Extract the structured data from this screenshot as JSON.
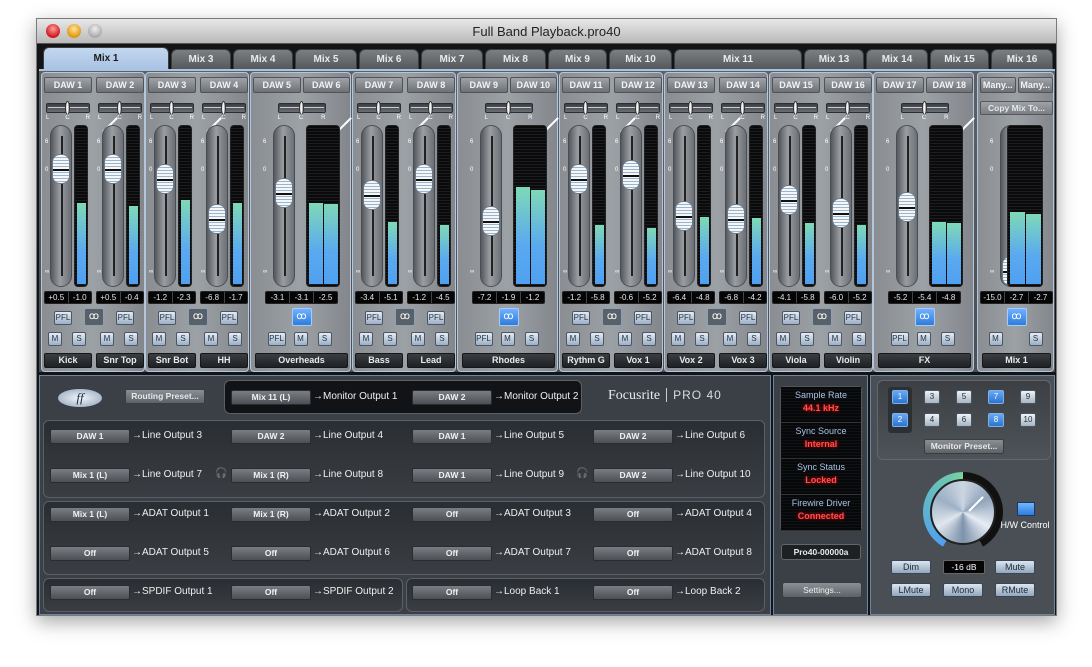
{
  "window": {
    "title": "Full Band Playback.pro40"
  },
  "tabs": [
    {
      "label": "Mix 1",
      "active": true
    },
    {
      "label": "Mix 3"
    },
    {
      "label": "Mix 4"
    },
    {
      "label": "Mix 5"
    },
    {
      "label": "Mix 6"
    },
    {
      "label": "Mix 7"
    },
    {
      "label": "Mix 8"
    },
    {
      "label": "Mix 9"
    },
    {
      "label": "Mix 10"
    },
    {
      "label": "Mix 11"
    },
    {
      "label": "Mix 13"
    },
    {
      "label": "Mix 14"
    },
    {
      "label": "Mix 15"
    },
    {
      "label": "Mix 16"
    }
  ],
  "channels": [
    {
      "name": "Kick",
      "stereo": false,
      "sources": [
        "DAW 1"
      ],
      "readouts": [
        "+0.5"
      ],
      "fader_db": 0.5,
      "meter": [
        0.52
      ]
    },
    {
      "name": "Snr Top",
      "stereo": false,
      "sources": [
        "DAW 2"
      ],
      "readouts": [
        "+0.5"
      ],
      "fader_db": 0.5,
      "meter": [
        0.5
      ]
    },
    {
      "name": "Snr Bot",
      "stereo": false,
      "sources": [
        "DAW 3"
      ],
      "readouts": [
        "-1.2"
      ],
      "fader_db": -1.2,
      "meter": [
        0.54
      ]
    },
    {
      "name": "HH",
      "stereo": false,
      "sources": [
        "DAW 4"
      ],
      "readouts": [
        "-6.8"
      ],
      "fader_db": -6.8,
      "meter": [
        0.52
      ]
    },
    {
      "name": "Overheads",
      "stereo": true,
      "sources": [
        "DAW 5",
        "DAW 6"
      ],
      "readouts": [
        "-3.1",
        "-3.1",
        "-2.5"
      ],
      "fader_db": -3.1,
      "meter": [
        0.52,
        0.51
      ]
    },
    {
      "name": "Bass",
      "stereo": false,
      "sources": [
        "DAW 7"
      ],
      "readouts": [
        "-3.4"
      ],
      "fader_db": -3.4,
      "meter": [
        0.4
      ]
    },
    {
      "name": "Lead",
      "stereo": false,
      "sources": [
        "DAW 8"
      ],
      "readouts": [
        "-1.2"
      ],
      "fader_db": -1.2,
      "meter": [
        0.38
      ]
    },
    {
      "name": "Rhodes",
      "stereo": true,
      "sources": [
        "DAW 9",
        "DAW 10"
      ],
      "readouts": [
        "-7.2",
        "-1.9",
        "-1.2"
      ],
      "fader_db": -7.2,
      "meter": [
        0.62,
        0.6
      ]
    },
    {
      "name": "Rythm G",
      "stereo": false,
      "sources": [
        "DAW 11"
      ],
      "readouts": [
        "-1.2"
      ],
      "fader_db": -1.2,
      "meter": [
        0.38
      ]
    },
    {
      "name": "Vox 1",
      "stereo": false,
      "sources": [
        "DAW 12"
      ],
      "readouts": [
        "-0.6"
      ],
      "fader_db": -0.6,
      "meter": [
        0.36
      ]
    },
    {
      "name": "Vox 2",
      "stereo": false,
      "sources": [
        "DAW 13"
      ],
      "readouts": [
        "-6.4"
      ],
      "fader_db": -6.4,
      "meter": [
        0.43
      ]
    },
    {
      "name": "Vox 3",
      "stereo": false,
      "sources": [
        "DAW 14"
      ],
      "readouts": [
        "-6.8"
      ],
      "fader_db": -6.8,
      "meter": [
        0.42
      ]
    },
    {
      "name": "Viola",
      "stereo": false,
      "sources": [
        "DAW 15"
      ],
      "readouts": [
        "-4.1"
      ],
      "fader_db": -4.1,
      "meter": [
        0.39
      ]
    },
    {
      "name": "Violin",
      "stereo": false,
      "sources": [
        "DAW 16"
      ],
      "readouts": [
        "-6.0"
      ],
      "fader_db": -6.0,
      "meter": [
        0.38
      ]
    },
    {
      "name": "FX",
      "stereo": true,
      "sources": [
        "DAW 17",
        "DAW 18"
      ],
      "readouts": [
        "-5.2",
        "-5.4",
        "-4.8"
      ],
      "fader_db": -5.2,
      "meter": [
        0.4,
        0.39
      ]
    },
    {
      "name": "Mix 1",
      "stereo": true,
      "master": true,
      "sources": [
        "Many...",
        "Many..."
      ],
      "readouts": [
        "-15.0",
        "-2.7",
        "-2.7"
      ],
      "fader_db": -15.0,
      "meter": [
        0.46,
        0.45
      ]
    }
  ],
  "pair_readouts": {
    "0": [
      "+0.5",
      "-1.0"
    ],
    "1": [
      "+0.5",
      "-0.4"
    ],
    "2": [
      "-1.2",
      "-2.3"
    ],
    "3": [
      "-6.8",
      "-1.7"
    ],
    "5": [
      "-3.4",
      "-5.1"
    ],
    "6": [
      "-1.2",
      "-4.5"
    ],
    "8": [
      "-1.2",
      "-5.8"
    ],
    "9": [
      "-0.6",
      "-5.2"
    ],
    "10": [
      "-6.4",
      "-4.8"
    ],
    "11": [
      "-6.8",
      "-4.2"
    ],
    "12": [
      "-4.1",
      "-5.8"
    ],
    "13": [
      "-6.0",
      "-5.2"
    ]
  },
  "labels": {
    "pfl": "PFL",
    "mute": "M",
    "solo": "S",
    "copy_mix": "Copy Mix To...",
    "scale_top": "6",
    "scale_mid": "0",
    "scale_bot": "∞",
    "pan_l": "L",
    "pan_c": "C",
    "pan_r": "R",
    "link_icon": "ꝏ"
  },
  "routing": {
    "logo_text": "ff",
    "preset_label": "Routing Preset...",
    "brand": "Focusrite",
    "brand_model": "PRO 40",
    "monitor": [
      {
        "source": "Mix 11 (L)",
        "dest": "→Monitor Output 1"
      },
      {
        "source": "DAW 2",
        "dest": "→Monitor Output 2"
      }
    ],
    "line": [
      {
        "source": "DAW 1",
        "dest": "→Line Output 3"
      },
      {
        "source": "DAW 2",
        "dest": "→Line Output 4"
      },
      {
        "source": "DAW 1",
        "dest": "→Line Output 5"
      },
      {
        "source": "DAW 2",
        "dest": "→Line Output 6"
      },
      {
        "source": "Mix 1 (L)",
        "dest": "→Line Output 7"
      },
      {
        "source": "Mix 1 (R)",
        "dest": "→Line Output 8"
      },
      {
        "source": "DAW 1",
        "dest": "→Line Output 9"
      },
      {
        "source": "DAW 2",
        "dest": "→Line Output 10"
      }
    ],
    "adat": [
      {
        "source": "Mix 1 (L)",
        "dest": "→ADAT Output 1"
      },
      {
        "source": "Mix 1 (R)",
        "dest": "→ADAT Output 2"
      },
      {
        "source": "Off",
        "dest": "→ADAT Output 3"
      },
      {
        "source": "Off",
        "dest": "→ADAT Output 4"
      },
      {
        "source": "Off",
        "dest": "→ADAT Output 5"
      },
      {
        "source": "Off",
        "dest": "→ADAT Output 6"
      },
      {
        "source": "Off",
        "dest": "→ADAT Output 7"
      },
      {
        "source": "Off",
        "dest": "→ADAT Output 8"
      }
    ],
    "spdif": [
      {
        "source": "Off",
        "dest": "→SPDIF Output 1"
      },
      {
        "source": "Off",
        "dest": "→SPDIF Output 2"
      }
    ],
    "loopback": [
      {
        "source": "Off",
        "dest": "→Loop Back 1"
      },
      {
        "source": "Off",
        "dest": "→Loop Back 2"
      }
    ],
    "headphone_icon": "🎧"
  },
  "status": {
    "items": [
      {
        "label": "Sample Rate",
        "value": "44.1 kHz"
      },
      {
        "label": "Sync Source",
        "value": "Internal"
      },
      {
        "label": "Sync Status",
        "value": "Locked"
      },
      {
        "label": "Firewire Driver",
        "value": "Connected"
      }
    ],
    "device": "Pro40-00000a",
    "settings_label": "Settings..."
  },
  "monitor": {
    "buttons": [
      {
        "label": "1",
        "on": true
      },
      {
        "label": "3",
        "on": false
      },
      {
        "label": "5",
        "on": false
      },
      {
        "label": "7",
        "on": true
      },
      {
        "label": "9",
        "on": false
      },
      {
        "label": "2",
        "on": true
      },
      {
        "label": "4",
        "on": false
      },
      {
        "label": "6",
        "on": false
      },
      {
        "label": "8",
        "on": true
      },
      {
        "label": "10",
        "on": false
      }
    ],
    "preset_label": "Monitor Preset...",
    "hw_label": "H/W Control",
    "level": "-16 dB",
    "dim": "Dim",
    "mute": "Mute",
    "lmute": "LMute",
    "mono": "Mono",
    "rmute": "RMute"
  }
}
